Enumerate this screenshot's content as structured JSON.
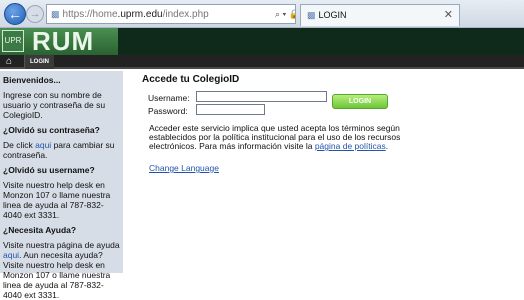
{
  "browser": {
    "url_prefix": "https://home",
    "url_domain": ".uprm.edu",
    "url_path": "/index.php",
    "addr_controls": "⌕ ▾ 🔒 C",
    "tab_title": "LOGIN",
    "tab_close": "✕"
  },
  "header": {
    "site_name": "RUM",
    "seal": "UPR"
  },
  "menu": {
    "home": "⌂",
    "login": "LOGIN"
  },
  "sidebar": {
    "welcome_head": "Bienvenidos...",
    "welcome_text": "Ingrese con su nombre de usuario y contraseña de su ColegioID.",
    "forgot_pw_head": "¿Olvidó su contraseña?",
    "forgot_pw_pre": "De click ",
    "forgot_pw_link": "aqui",
    "forgot_pw_post": " para cambiar su contraseña.",
    "forgot_user_head": "¿Olvidó su username?",
    "forgot_user_text": "Visite nuestro help desk en Monzon 107 o llame nuestra linea de ayuda al 787-832-4040 ext 3331.",
    "help_head": "¿Necesita Ayuda?",
    "help_pre": "Visite nuestra página de ayuda ",
    "help_link": "aqui",
    "help_post": ". Aun necesita ayuda? Visite nuestro help desk en Monzon 107 o llame nuestra linea de ayuda al 787-832-4040 ext 3331."
  },
  "main": {
    "title": "Accede tu ColegioID",
    "username_label": "Username:",
    "password_label": "Password:",
    "username_value": "",
    "password_value": "",
    "login_button": "LOGIN",
    "notice_text": "Acceder este servicio implica que usted acepta los términos según establecidos por la política institucional para el uso de los recursos electrónicos. Para más información visite la ",
    "notice_link": "página de políticas",
    "notice_end": ".",
    "change_language": "Change Language"
  },
  "colors": {
    "banner_green": "#2a6231",
    "sidebar_bg": "#d7dde6",
    "login_green": "#6cc63a",
    "link_blue": "#2255aa"
  }
}
